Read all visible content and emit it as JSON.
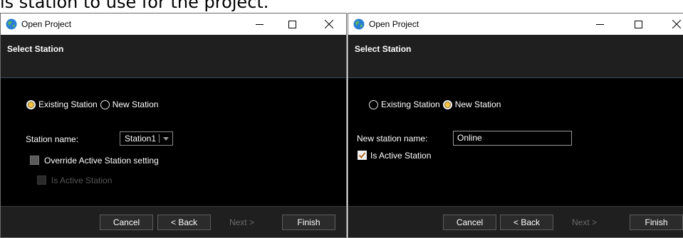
{
  "caption": "is station to use for the project.",
  "windows": [
    {
      "title": "Open Project",
      "header": "Select Station",
      "radios": [
        {
          "label": "Existing Station",
          "checked": true
        },
        {
          "label": "New Station",
          "checked": false
        }
      ],
      "station_name_label": "Station name:",
      "station_combo_value": "Station1",
      "override_label": "Override Active Station setting",
      "is_active_label": "Is Active Station",
      "buttons": {
        "cancel": "Cancel",
        "back": "< Back",
        "next": "Next >",
        "finish": "Finish"
      }
    },
    {
      "title": "Open Project",
      "header": "Select Station",
      "radios": [
        {
          "label": "Existing Station",
          "checked": false
        },
        {
          "label": "New Station",
          "checked": true
        }
      ],
      "new_station_label": "New station name:",
      "new_station_value": "Online",
      "is_active_label": "Is Active Station",
      "buttons": {
        "cancel": "Cancel",
        "back": "< Back",
        "next": "Next >",
        "finish": "Finish"
      }
    }
  ],
  "icons": {
    "app": "globe-icon",
    "minimize": "minimize-icon",
    "maximize": "maximize-icon",
    "close": "close-icon",
    "dropdown": "chevron-down-icon",
    "check": "check-icon"
  },
  "colors": {
    "dialog_background": "#000000",
    "header_background": "#1f1f1f",
    "radio_dot": "#f5c242",
    "text": "#ffffff",
    "disabled_text": "#555555"
  }
}
